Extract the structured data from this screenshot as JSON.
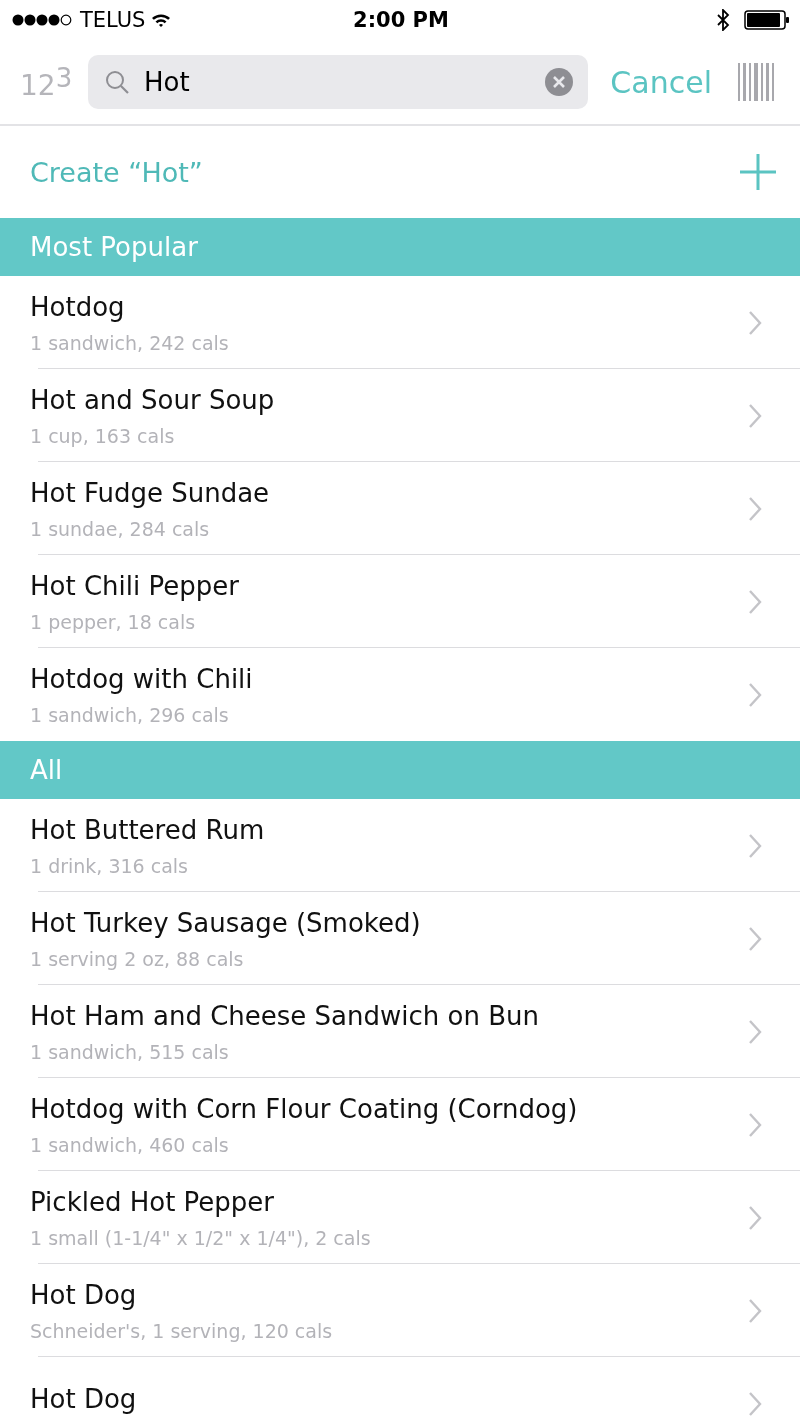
{
  "status_bar": {
    "carrier": "TELUS",
    "time": "2:00 PM"
  },
  "search": {
    "keypad_toggle": "12$^{3}$",
    "value": "Hot",
    "cancel": "Cancel"
  },
  "create": {
    "label": "Create “Hot”"
  },
  "sections": [
    {
      "title": "Most Popular",
      "items": [
        {
          "name": "Hotdog",
          "detail": "1 sandwich, 242 cals"
        },
        {
          "name": "Hot and Sour Soup",
          "detail": "1 cup, 163 cals"
        },
        {
          "name": "Hot Fudge Sundae",
          "detail": "1 sundae, 284 cals"
        },
        {
          "name": "Hot Chili Pepper",
          "detail": "1 pepper, 18 cals"
        },
        {
          "name": "Hotdog with Chili",
          "detail": "1 sandwich, 296 cals"
        }
      ]
    },
    {
      "title": "All",
      "items": [
        {
          "name": "Hot Buttered Rum",
          "detail": "1 drink, 316 cals"
        },
        {
          "name": "Hot Turkey Sausage (Smoked)",
          "detail": "1 serving 2 oz, 88 cals"
        },
        {
          "name": "Hot Ham and Cheese Sandwich on Bun",
          "detail": "1 sandwich, 515 cals"
        },
        {
          "name": "Hotdog with Corn Flour Coating (Corndog)",
          "detail": "1 sandwich, 460 cals"
        },
        {
          "name": "Pickled Hot Pepper",
          "detail": "1 small (1-1/4\" x 1/2\" x 1/4\"), 2 cals"
        },
        {
          "name": "Hot Dog",
          "detail": "Schneider's, 1 serving, 120 cals"
        },
        {
          "name": "Hot Dog"
        }
      ]
    }
  ]
}
